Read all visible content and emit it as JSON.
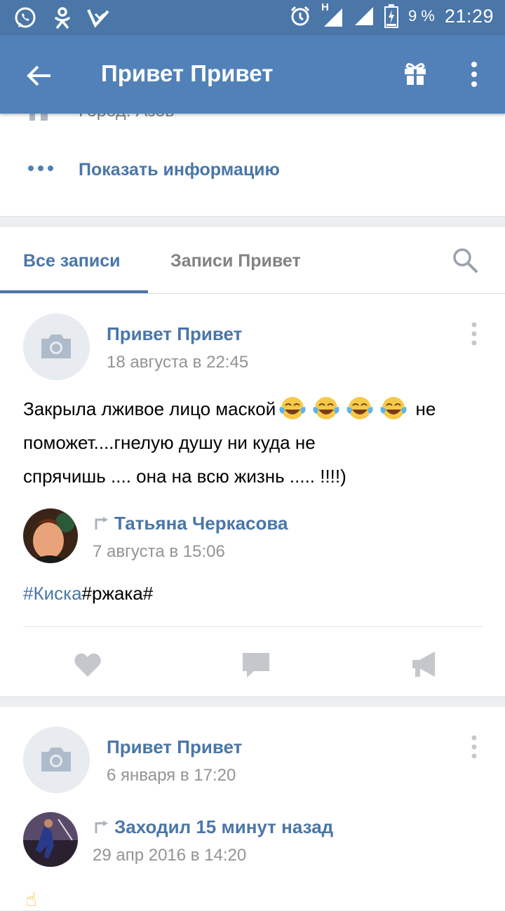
{
  "status_bar": {
    "network_label": "H",
    "battery": "9 %",
    "time": "21:29"
  },
  "header": {
    "title": "Привет Привет"
  },
  "profile_info": {
    "city_partial": "Город: Азов",
    "show_info_label": "Показать информацию"
  },
  "tabs": [
    {
      "label": "Все записи",
      "active": true
    },
    {
      "label": "Записи Привет",
      "active": false
    }
  ],
  "posts": [
    {
      "author": "Привет Привет",
      "date": "18 августа в 22:45",
      "text_line1_a": "Закрыла лживое  лицо маской",
      "text_line1_b": " не",
      "text_line2": "поможет....гнелую душу  ни куда не",
      "text_line3": "спрячишь .... она на всю жизнь ..... !!!!)",
      "emoji_count": 4,
      "repost": {
        "author": "Татьяна Черкасова",
        "date": "7 августа в 15:06",
        "hashtag_link": "#Киска",
        "hashtag_rest": "#ржака#"
      }
    },
    {
      "author": "Привет Привет",
      "date": "6 января в 17:20",
      "repost": {
        "author": "Заходил 15 минут назад",
        "date": "29 апр 2016 в 14:20"
      },
      "partial_text": "☝"
    }
  ],
  "colors": {
    "brand": "#5181b8",
    "statusbar": "#4a76a8",
    "link": "#4a76a8",
    "muted": "#939393",
    "background": "#edeef0"
  }
}
